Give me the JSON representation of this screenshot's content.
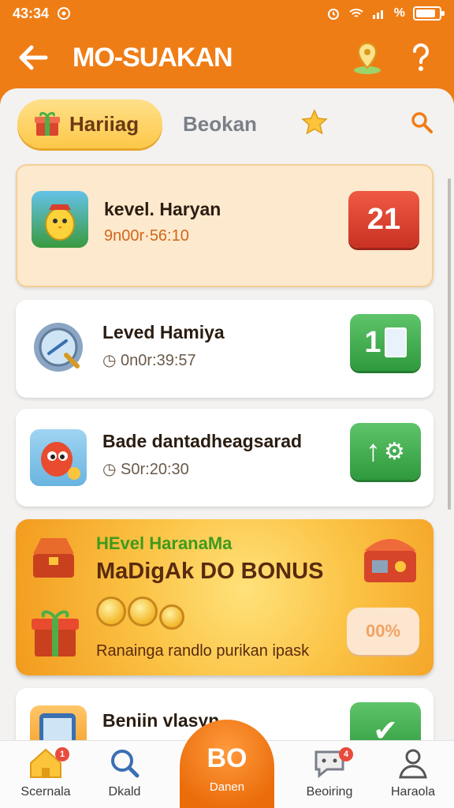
{
  "status": {
    "time": "43:34",
    "signal_text": "%",
    "battery_level": 0.85
  },
  "header": {
    "title": "MO-SUAKAN",
    "back_icon": "arrow-left-icon",
    "location_icon": "map-pin-icon",
    "help_icon": "question-icon"
  },
  "tabs": [
    {
      "label": "Hariiag",
      "active": true,
      "icon": "gift-icon"
    },
    {
      "label": "Beokan",
      "active": false
    },
    {
      "label": "",
      "icon": "star-icon"
    },
    {
      "label": "",
      "icon": "search-icon"
    }
  ],
  "cards": [
    {
      "title": "kevel. Haryan",
      "time": "9n00r·56:10",
      "badge": "21",
      "badge_color": "#d93d2d",
      "highlighted": true
    },
    {
      "title": "Leved Hamiya",
      "time": "0n0r:39:57",
      "badge": "1",
      "badge_color": "#3da94a",
      "highlighted": false
    },
    {
      "title": "Bade dantadheagsarad",
      "time": "S0r:20:30",
      "badge": "↑",
      "badge_color": "#3da94a",
      "highlighted": false
    }
  ],
  "bonus": {
    "subtitle": "HEvel HaranaMa",
    "title": "MaDigAk DO BONUS",
    "description": "Ranainga randlo purikan ipask",
    "button": "00%"
  },
  "partial_card": {
    "title": "Beniin vlasyn"
  },
  "nav": [
    {
      "label": "Scernala",
      "icon": "home-icon",
      "badge": "1"
    },
    {
      "label": "Dkald",
      "icon": "search-icon",
      "badge": ""
    },
    {
      "label": "Danen",
      "icon": "center-logo",
      "logo_text": "BO"
    },
    {
      "label": "Beoiring",
      "icon": "chat-icon",
      "badge": "4"
    },
    {
      "label": "Haraola",
      "icon": "user-icon",
      "badge": ""
    }
  ],
  "colors": {
    "primary": "#ef7d16",
    "sheet": "#f3f2f1",
    "highlight_card": "#fde9cd"
  }
}
